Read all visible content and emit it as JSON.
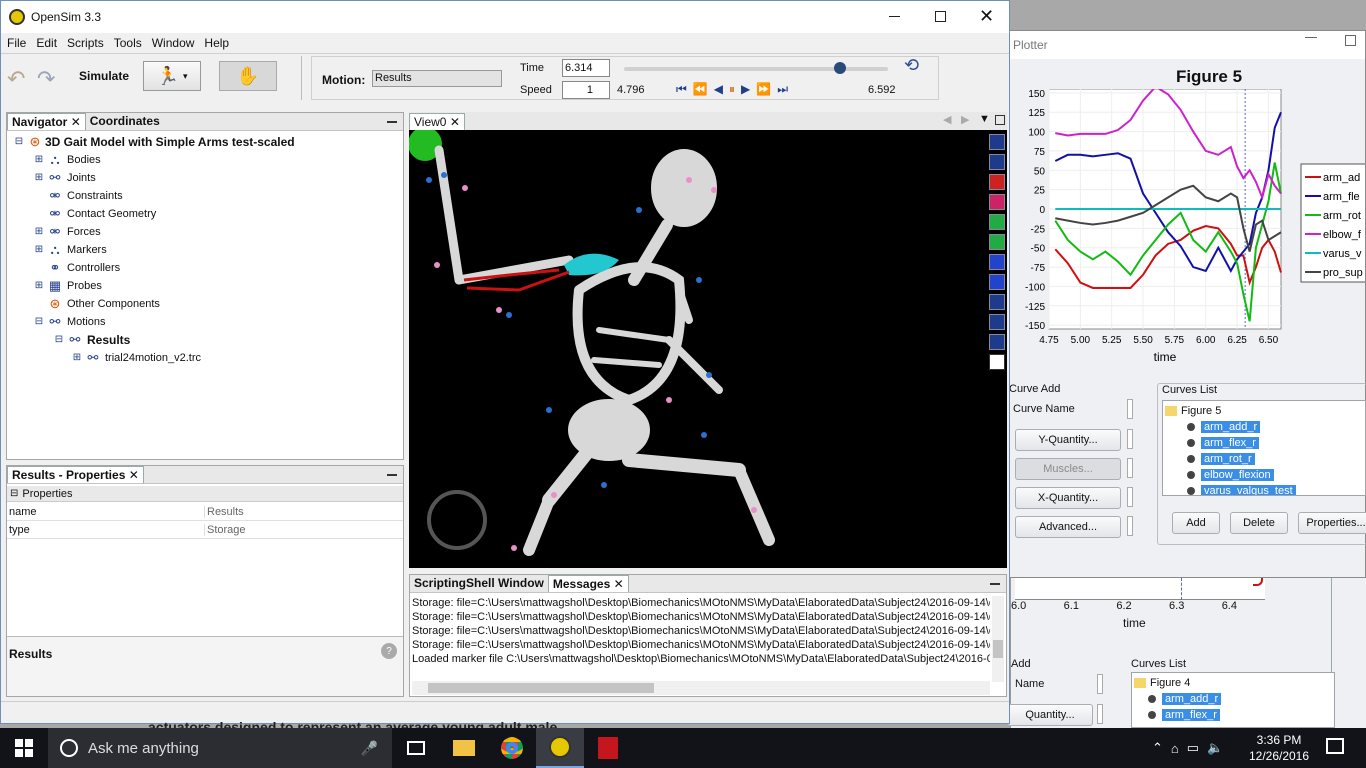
{
  "main_window": {
    "title": "OpenSim 3.3",
    "menu": [
      "File",
      "Edit",
      "Scripts",
      "Tools",
      "Window",
      "Help"
    ],
    "toolbar": {
      "simulate": "Simulate",
      "motion_label": "Motion:",
      "motion_value": "Results",
      "time_label": "Time",
      "time_value": "6.314",
      "speed_label": "Speed",
      "speed_value": "1",
      "start_time": "4.796",
      "end_time": "6.592",
      "slider_position": 0.82
    }
  },
  "navigator": {
    "tabs": [
      "Navigator",
      "Coordinates"
    ],
    "model": "3D Gait Model with Simple Arms test-scaled",
    "items": [
      "Bodies",
      "Joints",
      "Constraints",
      "Contact Geometry",
      "Forces",
      "Markers",
      "Controllers",
      "Probes",
      "Other Components",
      "Motions"
    ],
    "results": "Results",
    "trc": "trial24motion_v2.trc"
  },
  "properties": {
    "tab": "Results - Properties",
    "section": "Properties",
    "rows": [
      {
        "key": "name",
        "value": "Results"
      },
      {
        "key": "type",
        "value": "Storage"
      }
    ],
    "footer": "Results"
  },
  "view": {
    "tab": "View0"
  },
  "messages": {
    "tabs": [
      "ScriptingShell Window",
      "Messages"
    ],
    "lines": [
      "Storage: file=C:\\Users\\mattwagshol\\Desktop\\Biomechanics\\MOtoNMS\\MyData\\ElaboratedData\\Subject24\\2016-09-14\\d",
      "Storage: file=C:\\Users\\mattwagshol\\Desktop\\Biomechanics\\MOtoNMS\\MyData\\ElaboratedData\\Subject24\\2016-09-14\\d",
      "Storage: file=C:\\Users\\mattwagshol\\Desktop\\Biomechanics\\MOtoNMS\\MyData\\ElaboratedData\\Subject24\\2016-09-14\\d",
      "Storage: file=C:\\Users\\mattwagshol\\Desktop\\Biomechanics\\MOtoNMS\\MyData\\ElaboratedData\\Subject24\\2016-09-14\\d",
      "Loaded marker file C:\\Users\\mattwagshol\\Desktop\\Biomechanics\\MOtoNMS\\MyData\\ElaboratedData\\Subject24\\2016-09-"
    ]
  },
  "plotter": {
    "title": "Plotter",
    "figure_title": "Figure 5",
    "xlabel": "time",
    "legend": [
      "arm_ad",
      "arm_fle",
      "arm_rot",
      "elbow_f",
      "varus_v",
      "pro_sup"
    ],
    "curve_add": "Curve Add",
    "curve_name": "Curve Name",
    "buttons": [
      "Y-Quantity...",
      "Muscles...",
      "X-Quantity...",
      "Advanced..."
    ],
    "curves_list": "Curves List",
    "figure_node": "Figure 5",
    "curves": [
      "arm_add_r",
      "arm_flex_r",
      "arm_rot_r",
      "elbow_flexion",
      "varus_valgus_test"
    ],
    "bottom_buttons": [
      "Add",
      "Delete",
      "Properties..."
    ]
  },
  "bg_plotter": {
    "ticks": [
      "6.0",
      "6.1",
      "6.2",
      "6.3",
      "6.4"
    ],
    "xlabel": "time",
    "curve_add": "Add",
    "curve_name": "Name",
    "quantity": "Quantity...",
    "curves_list": "Curves List",
    "figure_node": "Figure 4",
    "curves": [
      "arm_add_r",
      "arm_flex_r"
    ]
  },
  "doc_text": "actuators designed to represent an average young adult male",
  "taskbar": {
    "search": "Ask me anything",
    "time": "3:36 PM",
    "date": "12/26/2016"
  },
  "colors": {
    "arm_add": "#cc1111",
    "arm_flex": "#1111aa",
    "arm_rot": "#11bb11",
    "elbow_flex": "#cc22cc",
    "varus": "#11bbbb",
    "pro_sup": "#444444",
    "selection": "#3a8ee6"
  },
  "chart_data": {
    "type": "line",
    "title": "Figure 5",
    "xlabel": "time",
    "ylabel": "",
    "xlim": [
      4.75,
      6.6
    ],
    "ylim": [
      -155,
      155
    ],
    "x": [
      4.8,
      4.9,
      5.0,
      5.1,
      5.2,
      5.3,
      5.4,
      5.5,
      5.6,
      5.7,
      5.8,
      5.9,
      6.0,
      6.1,
      6.2,
      6.25,
      6.3,
      6.35,
      6.4,
      6.45,
      6.5,
      6.55,
      6.6
    ],
    "series": [
      {
        "name": "arm_ad",
        "values": [
          -52,
          -70,
          -95,
          -102,
          -102,
          -102,
          -102,
          -85,
          -60,
          -45,
          -40,
          -28,
          -22,
          -25,
          -45,
          -60,
          -60,
          -95,
          -75,
          -50,
          -40,
          -55,
          -82
        ]
      },
      {
        "name": "arm_fle",
        "values": [
          62,
          70,
          70,
          68,
          70,
          72,
          65,
          20,
          -5,
          -30,
          -48,
          -75,
          -80,
          -50,
          -80,
          -65,
          -55,
          -45,
          -5,
          15,
          50,
          105,
          125
        ]
      },
      {
        "name": "arm_rot",
        "values": [
          -15,
          -40,
          -55,
          -65,
          -55,
          -68,
          -85,
          -60,
          -40,
          -20,
          -5,
          -40,
          -55,
          -30,
          -55,
          -70,
          -110,
          -145,
          -50,
          -20,
          10,
          60,
          20
        ]
      },
      {
        "name": "elbow_f",
        "values": [
          98,
          95,
          97,
          97,
          97,
          102,
          115,
          140,
          158,
          148,
          128,
          100,
          75,
          70,
          80,
          55,
          40,
          50,
          35,
          15,
          45,
          30,
          20
        ]
      },
      {
        "name": "varus_v",
        "values": [
          0,
          0,
          0,
          0,
          0,
          0,
          0,
          0,
          0,
          0,
          0,
          0,
          0,
          0,
          0,
          0,
          0,
          0,
          0,
          0,
          0,
          0,
          0
        ]
      },
      {
        "name": "pro_sup",
        "values": [
          -12,
          -15,
          -18,
          -20,
          -18,
          -15,
          -10,
          -5,
          5,
          15,
          25,
          30,
          15,
          10,
          20,
          15,
          -25,
          -55,
          -20,
          -15,
          -40,
          -35,
          -30
        ]
      }
    ]
  }
}
